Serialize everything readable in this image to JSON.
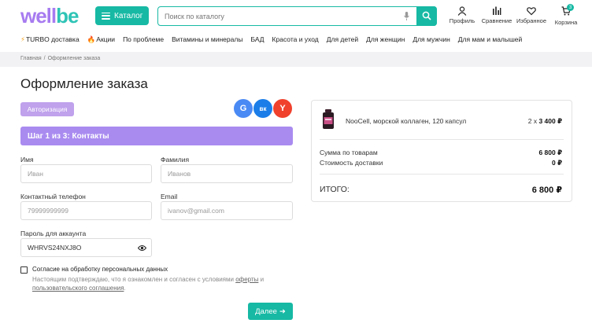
{
  "header": {
    "logo_part1": "well",
    "logo_part2": "be",
    "catalog_label": "Каталог",
    "search_placeholder": "Поиск по каталогу",
    "icons": [
      {
        "icon": "user-icon",
        "label": "Профиль"
      },
      {
        "icon": "compare-icon",
        "label": "Сравнение"
      },
      {
        "icon": "heart-icon",
        "label": "Избранное"
      },
      {
        "icon": "cart-icon",
        "label": "Корзина"
      }
    ],
    "cart_count": "3"
  },
  "nav": {
    "items": [
      {
        "label": "TURBO доставка",
        "icon": "lightning-icon"
      },
      {
        "label": "Акции",
        "icon": "fire-icon"
      },
      {
        "label": "По проблеме"
      },
      {
        "label": "Витамины и минералы"
      },
      {
        "label": "БАД"
      },
      {
        "label": "Красота и уход"
      },
      {
        "label": "Для детей"
      },
      {
        "label": "Для женщин"
      },
      {
        "label": "Для мужчин"
      },
      {
        "label": "Для мам и малышей"
      }
    ]
  },
  "breadcrumb": {
    "home": "Главная",
    "separator": "/",
    "current": "Оформление заказа"
  },
  "page": {
    "title": "Оформление заказа",
    "auth_button": "Авторизация",
    "social": [
      {
        "icon": "google-icon",
        "glyph": "G",
        "color": "#4a8af4"
      },
      {
        "icon": "vk-icon",
        "glyph": "вк",
        "color": "#1a7de8"
      },
      {
        "icon": "yandex-icon",
        "glyph": "Y",
        "color": "#f0412d"
      }
    ],
    "step_label": "Шаг 1 из 3: Контакты"
  },
  "form": {
    "first_name": {
      "label": "Имя",
      "placeholder": "Иван"
    },
    "last_name": {
      "label": "Фамилия",
      "placeholder": "Иванов"
    },
    "phone": {
      "label": "Контактный телефон",
      "placeholder": "79999999999"
    },
    "email": {
      "label": "Email",
      "placeholder": "ivanov@gmail.com"
    },
    "password": {
      "label": "Пароль для аккаунта",
      "value": "WHRVS24NXJ8O"
    },
    "consent_label": "Согласие на обработку персональных данных",
    "consent_note_start": "Настоящим подтверждаю, что я ознакомлен и согласен с условиями ",
    "consent_link1": "оферты",
    "consent_and": " и ",
    "consent_link2": "пользовательского соглашения",
    "consent_end": ".",
    "next_button": "Далее"
  },
  "summary": {
    "product_name": "NooCell, морской коллаген, 120 капсул",
    "quantity": "2 x",
    "unit_price": "3 400 ₽",
    "subtotal_label": "Сумма по товарам",
    "subtotal_value": "6 800 ₽",
    "delivery_label": "Стоимость доставки",
    "delivery_value": "0 ₽",
    "total_label": "ИТОГО:",
    "total_value": "6 800 ₽"
  },
  "colors": {
    "accent": "#17b9a4",
    "purple": "#a98bf0",
    "auth": "#bfa1ec"
  }
}
